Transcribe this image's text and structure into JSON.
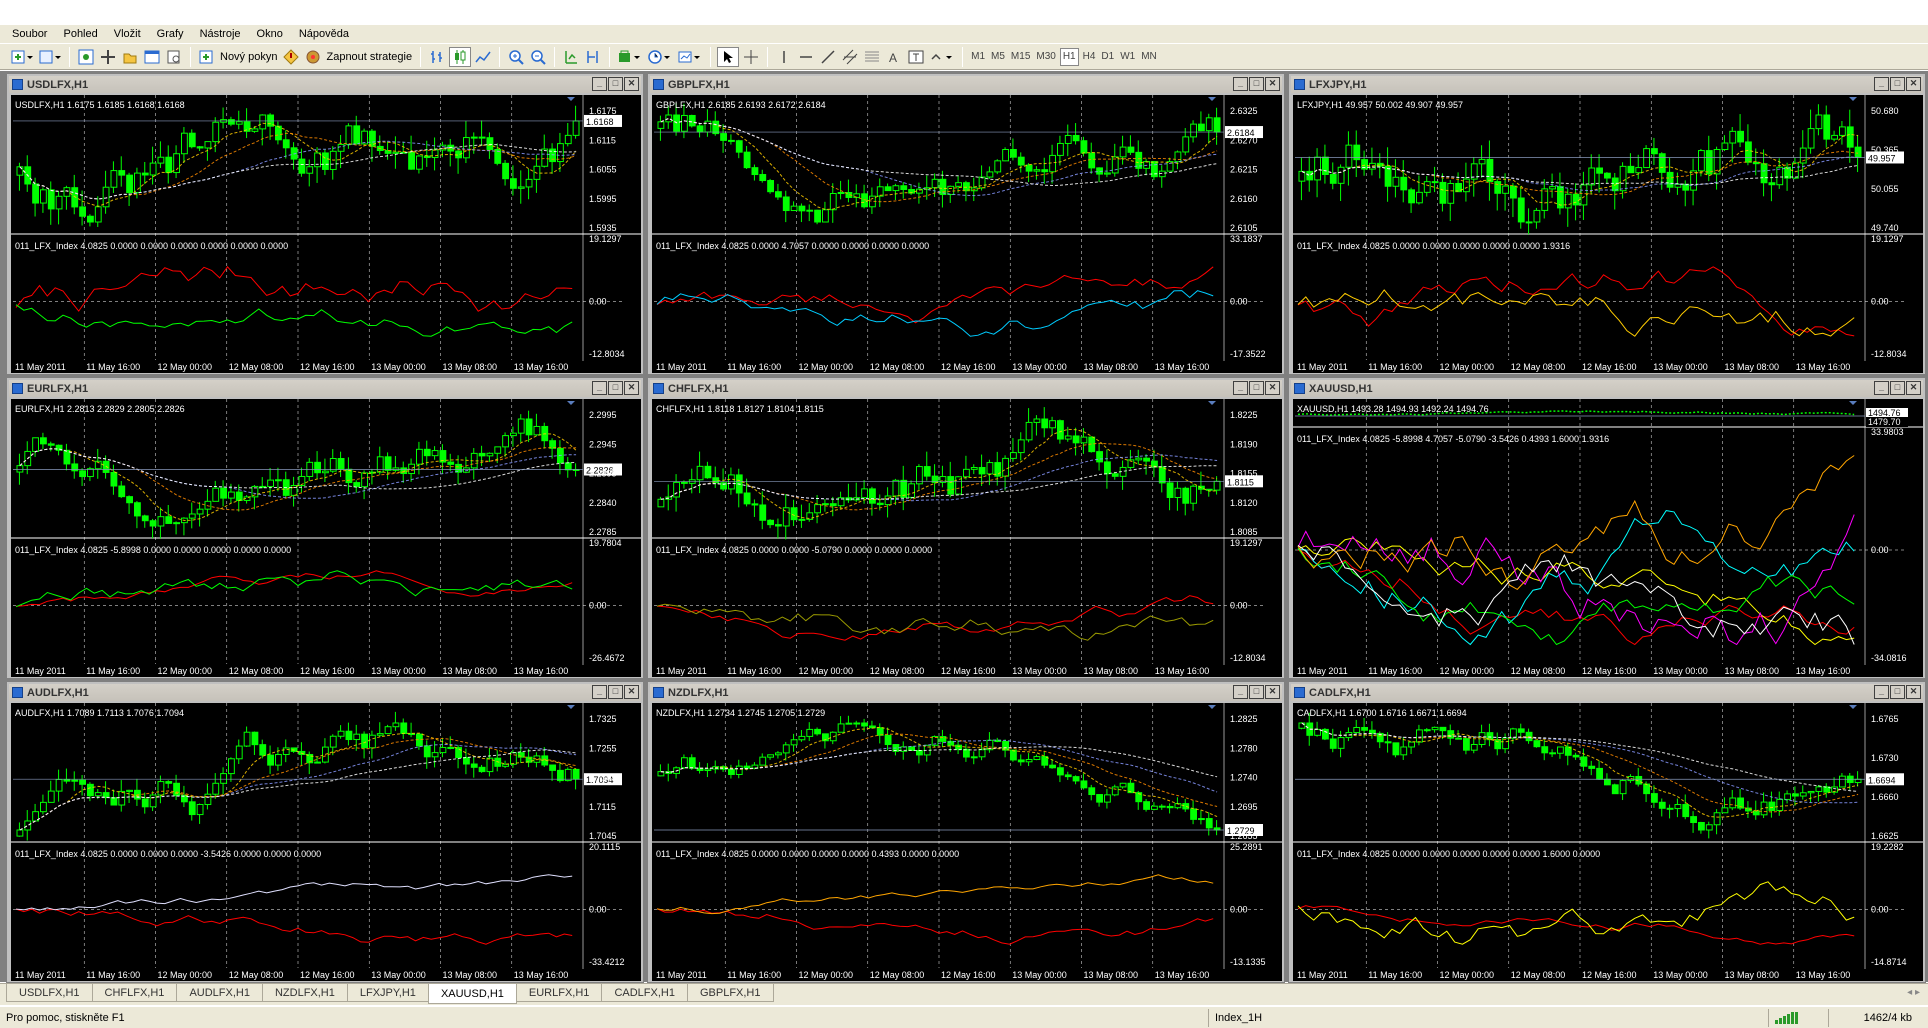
{
  "menu": [
    "Soubor",
    "Pohled",
    "Vložit",
    "Grafy",
    "Nástroje",
    "Okno",
    "Nápověda"
  ],
  "toolbar": {
    "new_order": "Nový pokyn",
    "strategy": "Zapnout strategie",
    "timeframes": [
      "M1",
      "M5",
      "M15",
      "M30",
      "H1",
      "H4",
      "D1",
      "W1",
      "MN"
    ],
    "active_tf": "H1"
  },
  "charts": [
    {
      "title": "USDLFX,H1",
      "ohlc": "USDLFX,H1  1.6175 1.6185 1.6168 1.6168",
      "price_axis": [
        "1.6175",
        "1.6115",
        "1.6055",
        "1.5995",
        "1.5935"
      ],
      "current_price": "1.6168",
      "indicator": "011_LFX_Index 4.0825 0.0000 0.0000 0.0000 0.0000 0.0000 0.0000",
      "ind_axis": [
        "19.1297",
        "0.00",
        "-12.8034"
      ]
    },
    {
      "title": "GBPLFX,H1",
      "ohlc": "GBPLFX,H1  2.6185 2.6193 2.6172 2.6184",
      "price_axis": [
        "2.6325",
        "2.6270",
        "2.6215",
        "2.6160",
        "2.6105"
      ],
      "current_price": "2.6184",
      "indicator": "011_LFX_Index 4.0825 0.0000 4.7057 0.0000 0.0000 0.0000 0.0000",
      "ind_axis": [
        "33.1837",
        "0.00",
        "-17.3522"
      ]
    },
    {
      "title": "LFXJPY,H1",
      "ohlc": "LFXJPY,H1  49.957 50.002 49.907 49.957",
      "price_axis": [
        "50.680",
        "50.365",
        "50.055",
        "49.740"
      ],
      "current_price": "49.957",
      "indicator": "011_LFX_Index 4.0825 0.0000 0.0000 0.0000 0.0000 0.0000 1.9316",
      "ind_axis": [
        "19.1297",
        "0.00",
        "-12.8034"
      ]
    },
    {
      "title": "EURLFX,H1",
      "ohlc": "EURLFX,H1  2.2813 2.2829 2.2805 2.2826",
      "price_axis": [
        "2.2995",
        "2.2945",
        "2.2895",
        "2.2840",
        "2.2785"
      ],
      "current_price": "2.2826",
      "indicator": "011_LFX_Index 4.0825 -5.8998 0.0000 0.0000 0.0000 0.0000 0.0000",
      "ind_axis": [
        "19.7804",
        "0.00",
        "-26.4672"
      ]
    },
    {
      "title": "CHFLFX,H1",
      "ohlc": "CHFLFX,H1  1.8118 1.8127 1.8104 1.8115",
      "price_axis": [
        "1.8225",
        "1.8190",
        "1.8155",
        "1.8120",
        "1.8085"
      ],
      "current_price": "1.8115",
      "indicator": "011_LFX_Index 4.0825 0.0000 0.0000 -5.0790 0.0000 0.0000 0.0000",
      "ind_axis": [
        "19.1297",
        "0.00",
        "-12.8034"
      ]
    },
    {
      "title": "XAUUSD,H1",
      "ohlc": "XAUUSD,H1  1493.28 1494.93 1492.24 1494.76",
      "price_axis": [
        "1494.76",
        "1479.70"
      ],
      "current_price": "1494.76",
      "indicator": "011_LFX_Index 4.0825 -5.8998 4.7057 -5.0790 -3.5426 0.4393 1.6000 1.9316",
      "ind_axis": [
        "33.9803",
        "0.00",
        "-34.0816"
      ]
    },
    {
      "title": "AUDLFX,H1",
      "ohlc": "AUDLFX,H1  1.7089 1.7113 1.7076 1.7094",
      "price_axis": [
        "1.7325",
        "1.7255",
        "1.7185",
        "1.7115",
        "1.7045"
      ],
      "current_price": "1.7094",
      "indicator": "011_LFX_Index 4.0825 0.0000 0.0000 0.0000 -3.5426 0.0000 0.0000 0.0000",
      "ind_axis": [
        "20.1115",
        "0.00",
        "-33.4212"
      ]
    },
    {
      "title": "NZDLFX,H1",
      "ohlc": "NZDLFX,H1  1.2734 1.2745 1.2705 1.2729",
      "price_axis": [
        "1.2825",
        "1.2780",
        "1.2740",
        "1.2695",
        "1.2655"
      ],
      "current_price": "1.2729",
      "indicator": "011_LFX_Index 4.0825 0.0000 0.0000 0.0000 0.0000 0.4393 0.0000 0.0000",
      "ind_axis": [
        "25.2891",
        "0.00",
        "-13.1335"
      ]
    },
    {
      "title": "CADLFX,H1",
      "ohlc": "CADLFX,H1  1.6700 1.6716 1.6671 1.6694",
      "price_axis": [
        "1.6765",
        "1.6730",
        "1.6660",
        "1.6625"
      ],
      "current_price": "1.6694",
      "indicator": "011_LFX_Index 4.0825 0.0000 0.0000 0.0000 0.0000 0.0000 1.6000 0.0000",
      "ind_axis": [
        "19.2282",
        "0.00",
        "-14.8714"
      ]
    }
  ],
  "time_labels": [
    "11 May 2011",
    "11 May 16:00",
    "12 May 00:00",
    "12 May 08:00",
    "12 May 16:00",
    "13 May 00:00",
    "13 May 08:00",
    "13 May 16:00"
  ],
  "tabs": [
    "USDLFX,H1",
    "CHFLFX,H1",
    "AUDLFX,H1",
    "NZDLFX,H1",
    "LFXJPY,H1",
    "XAUUSD,H1",
    "EURLFX,H1",
    "CADLFX,H1",
    "GBPLFX,H1"
  ],
  "active_tab": "XAUUSD,H1",
  "status": {
    "help": "Pro pomoc, stiskněte F1",
    "profile": "Index_1H",
    "traffic": "1462/4 kb"
  },
  "colors": {
    "candle": "#00ff00",
    "background": "#000000",
    "grid": "#ffffff",
    "ma_yellow": "#ffcc00",
    "ma_orange": "#ff8c00",
    "ma_blue": "#8899ff",
    "ind_red": "#ff0000"
  }
}
